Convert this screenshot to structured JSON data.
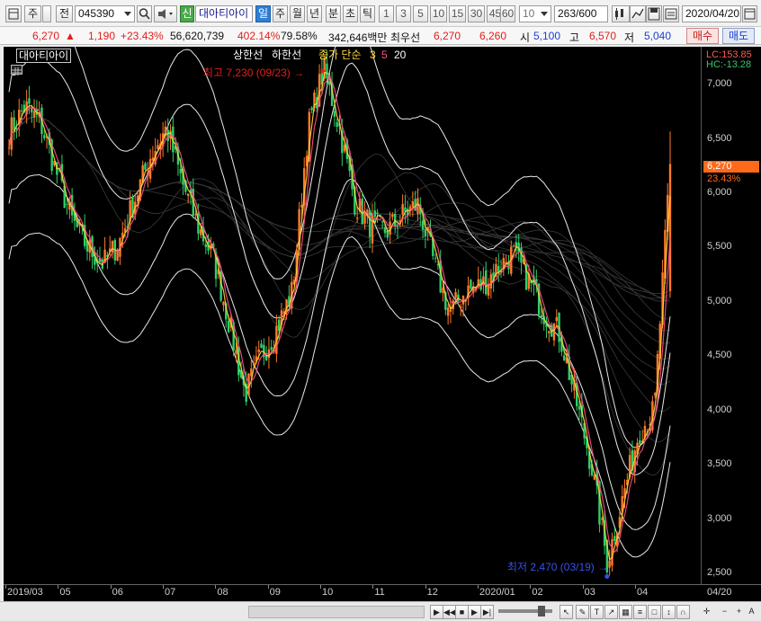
{
  "toolbar": {
    "period_buttons": [
      "주",
      "전"
    ],
    "stock_code": "045390",
    "name_prefix": "신",
    "stock_name": "대아티아이",
    "interval_buttons": [
      "일",
      "주",
      "월",
      "년",
      "분",
      "초",
      "틱"
    ],
    "selected_interval": "일",
    "minute_buttons": [
      "1",
      "3",
      "5",
      "10",
      "15",
      "30",
      "45",
      "60"
    ],
    "minute_value": "10",
    "count_value": "263",
    "count_total": "/600",
    "date_value": "2020/04/20"
  },
  "quote": {
    "price": "6,270",
    "up_arrow": "▲",
    "change": "1,190",
    "change_rate": "+23.43%",
    "volume": "56,620,739",
    "volume_rate": "402.14%",
    "turnover": "79.58%",
    "amount": "342,646백만",
    "best_label": "최우선",
    "best_ask": "6,270",
    "best_bid": "6,260",
    "open_label": "시",
    "open": "5,100",
    "high_label": "고",
    "high": "6,570",
    "low_label": "저",
    "low": "5,040",
    "buy_button": "매수",
    "sell_button": "매도"
  },
  "chart_legend": {
    "title": "대아티아이",
    "upper_limit": "상한선",
    "lower_limit": "하한선",
    "ma_label": "종가 단순",
    "ma_periods": [
      "3",
      "5",
      "20"
    ],
    "ma_colors": [
      "#ffd83a",
      "#ff4b8c",
      "#ffffff"
    ]
  },
  "annotations": {
    "high_marker": "최고 7,230 (09/23) →",
    "low_marker": "최저 2,470 (03/19) →"
  },
  "yaxis": {
    "lc": "LC:153.85",
    "hc": "HC:-13.28",
    "price_tag": "6,270",
    "pct_tag": "23.43%"
  },
  "chart_data": {
    "type": "candlestick",
    "y_ticks": [
      "7,000",
      "6,500",
      "6,000",
      "5,500",
      "5,000",
      "4,500",
      "4,000",
      "3,500",
      "3,000",
      "2,500"
    ],
    "x_ticks": [
      "2019/03",
      "05",
      "06",
      "07",
      "08",
      "09",
      "10",
      "11",
      "12",
      "2020/01",
      "02",
      "03",
      "04",
      "04/20"
    ],
    "ylim": [
      2400,
      7350
    ],
    "close_path": [
      [
        "2019/03",
        6550
      ],
      [
        "03-mid",
        6800
      ],
      [
        "04-early",
        6650
      ],
      [
        "04-mid",
        6200
      ],
      [
        "04-late",
        5750
      ],
      [
        "05-early",
        5500
      ],
      [
        "05-mid",
        5350
      ],
      [
        "05-late",
        5550
      ],
      [
        "06-early",
        5950
      ],
      [
        "06-mid",
        6350
      ],
      [
        "06-late",
        6600
      ],
      [
        "07-early",
        6100
      ],
      [
        "07-mid",
        5700
      ],
      [
        "07-late",
        5400
      ],
      [
        "08-early",
        4800
      ],
      [
        "08-mid",
        4150
      ],
      [
        "08-late",
        4500
      ],
      [
        "09-early",
        4750
      ],
      [
        "09-mid",
        5100
      ],
      [
        "09-late",
        6600
      ],
      [
        "09-23",
        7150
      ],
      [
        "10-early",
        6600
      ],
      [
        "10-mid",
        5900
      ],
      [
        "10-late",
        5700
      ],
      [
        "11-early",
        5650
      ],
      [
        "11-mid",
        5800
      ],
      [
        "11-late",
        5900
      ],
      [
        "12-early",
        5350
      ],
      [
        "12-mid",
        4900
      ],
      [
        "12-late",
        5100
      ],
      [
        "2020/01-early",
        5150
      ],
      [
        "01-mid",
        5300
      ],
      [
        "01-late",
        5450
      ],
      [
        "02-early",
        5200
      ],
      [
        "02-mid",
        4900
      ],
      [
        "02-late",
        4700
      ],
      [
        "03-early",
        4100
      ],
      [
        "03-mid",
        3500
      ],
      [
        "03-19",
        2600
      ],
      [
        "03-late",
        3200
      ],
      [
        "04-early",
        3800
      ],
      [
        "04-mid",
        4000
      ],
      [
        "04/20",
        6270
      ]
    ]
  }
}
